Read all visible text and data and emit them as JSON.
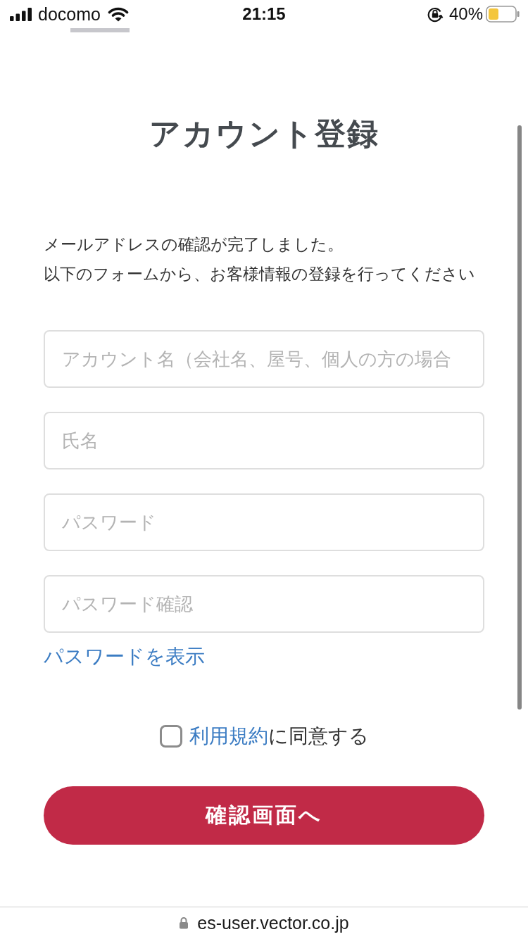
{
  "status_bar": {
    "carrier": "docomo",
    "time": "21:15",
    "battery_percent": "40%"
  },
  "title": "アカウント登録",
  "intro": [
    "メールアドレスの確認が完了しました。",
    "以下のフォームから、お客様情報の登録を行ってください"
  ],
  "fields": [
    {
      "placeholder": "アカウント名（会社名、屋号、個人の方の場合"
    },
    {
      "placeholder": "氏名"
    },
    {
      "placeholder": "パスワード"
    },
    {
      "placeholder": "パスワード確認"
    }
  ],
  "show_password_link": "パスワードを表示",
  "agreement": {
    "checked": false,
    "link": "利用規約",
    "text": "に同意する"
  },
  "submit_button": "確認画面へ",
  "address_bar": {
    "url": "es-user.vector.co.jp"
  }
}
